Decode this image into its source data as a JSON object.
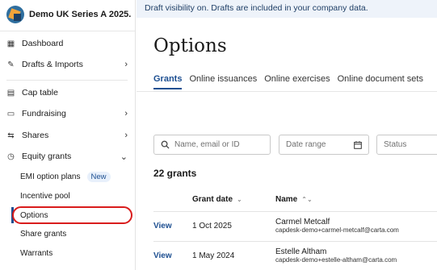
{
  "company": {
    "name": "Demo UK Series A 2025."
  },
  "nav": {
    "dashboard": "Dashboard",
    "drafts_imports": "Drafts & Imports",
    "cap_table": "Cap table",
    "fundraising": "Fundraising",
    "shares": "Shares",
    "equity_grants": "Equity grants"
  },
  "equity_sub": {
    "emi": "EMI option plans",
    "emi_badge": "New",
    "incentive_pool": "Incentive pool",
    "options": "Options",
    "share_grants": "Share grants",
    "warrants": "Warrants"
  },
  "banner": {
    "text": "Draft visibility on. Drafts are included in your company data."
  },
  "page": {
    "title": "Options"
  },
  "tabs": [
    "Grants",
    "Online issuances",
    "Online exercises",
    "Online document sets"
  ],
  "filters": {
    "search_placeholder": "Name, email or ID",
    "date_placeholder": "Date range",
    "status_placeholder": "Status"
  },
  "grants": {
    "count_label": "22 grants",
    "columns": {
      "grant_date": "Grant date",
      "name": "Name"
    },
    "rows": [
      {
        "action": "View",
        "date": "1 Oct 2025",
        "name": "Carmel Metcalf",
        "email": "capdesk-demo+carmel-metcalf@carta.com"
      },
      {
        "action": "View",
        "date": "1 May 2024",
        "name": "Estelle Altham",
        "email": "capdesk-demo+estelle-altham@carta.com"
      }
    ]
  },
  "colors": {
    "accent": "#1d4f91",
    "highlight": "#d91c1c",
    "banner_bg": "#eef3fa"
  }
}
